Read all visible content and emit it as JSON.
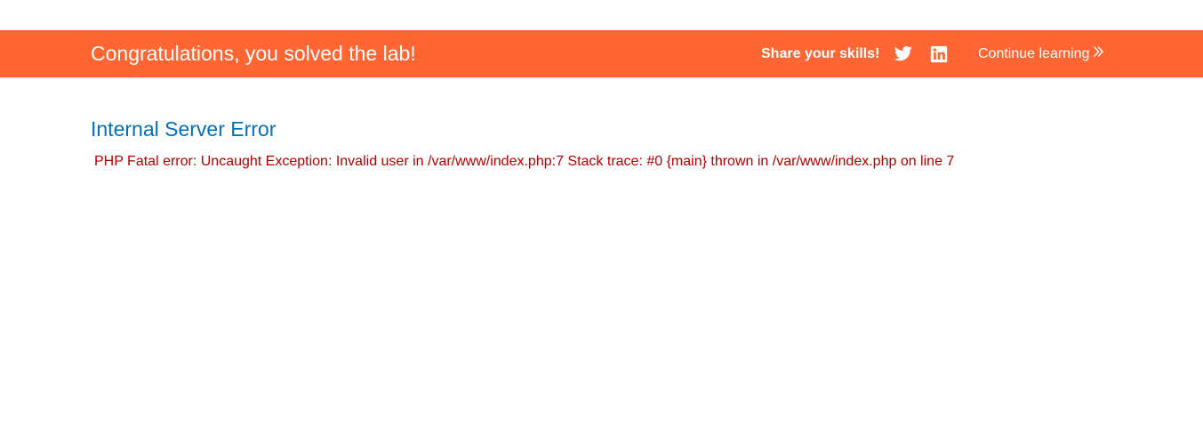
{
  "banner": {
    "title": "Congratulations, you solved the lab!",
    "share_label": "Share your skills!",
    "twitter_icon": "twitter-icon",
    "linkedin_icon": "linkedin-icon",
    "continue_label": "Continue learning",
    "continue_icon": "double-chevron-right-icon",
    "background_color": "#ff6633"
  },
  "main": {
    "error_title": "Internal Server Error",
    "error_message": "PHP Fatal error: Uncaught Exception: Invalid user in /var/www/index.php:7 Stack trace: #0 {main} thrown in /var/www/index.php on line 7",
    "title_color": "#0071bc",
    "message_color": "#b50000"
  }
}
